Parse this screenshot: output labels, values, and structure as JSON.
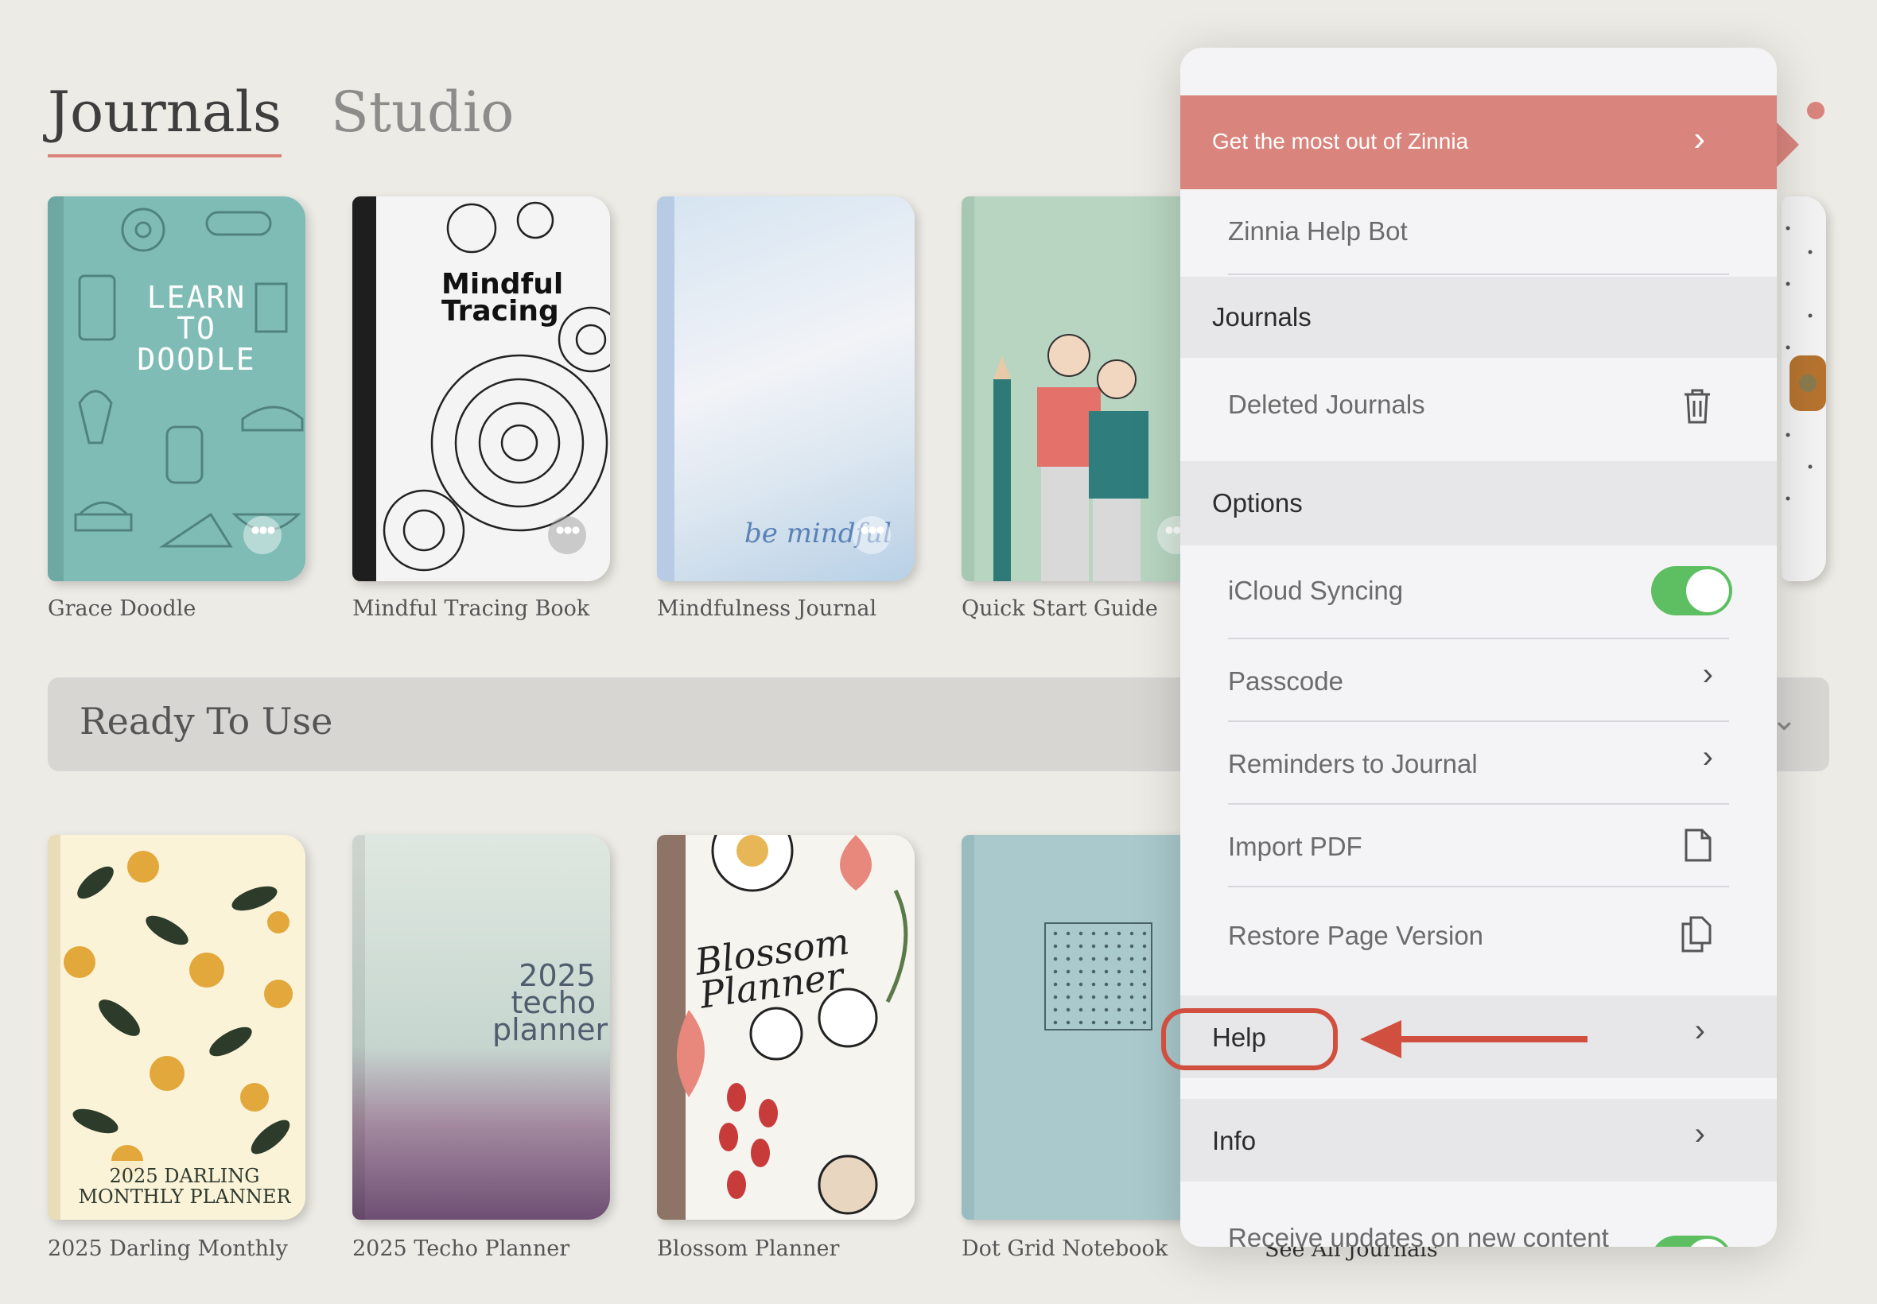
{
  "tabs": {
    "journals": "Journals",
    "studio": "Studio"
  },
  "journals": [
    {
      "caption": "Grace Doodle",
      "cover_text": "LEARN TO DOODLE"
    },
    {
      "caption": "Mindful Tracing Book",
      "cover_text": "Mindful Tracing"
    },
    {
      "caption": "Mindfulness Journal",
      "cover_text": "be mindful"
    },
    {
      "caption": "Quick Start Guide"
    }
  ],
  "ready_section": {
    "label": "Ready To Use"
  },
  "templates": [
    {
      "caption": "2025 Darling Monthly",
      "cover_text": "2025 DARLING MONTHLY PLANNER"
    },
    {
      "caption": "2025 Techo Planner",
      "cover_text": "2025 techo planner"
    },
    {
      "caption": "Blossom Planner",
      "cover_text": "Blossom Planner"
    },
    {
      "caption": "Dot Grid Notebook"
    }
  ],
  "see_all": "See All Journals",
  "more_glyph": "•••",
  "menu": {
    "promo": "Get the most out of Zinnia",
    "help_bot": "Zinnia Help Bot",
    "journals_header": "Journals",
    "deleted_journals": "Deleted Journals",
    "options_header": "Options",
    "icloud_syncing": "iCloud Syncing",
    "icloud_on": true,
    "passcode": "Passcode",
    "reminders": "Reminders to Journal",
    "import_pdf": "Import PDF",
    "restore_page": "Restore Page Version",
    "help": "Help",
    "info": "Info",
    "receive_updates": "Receive updates on new content",
    "receive_updates_on": true
  },
  "colors": {
    "accent": "#d9857d",
    "annotation": "#d14f3e",
    "toggle_on": "#5dbf62",
    "background": "#edebe5"
  },
  "icons": {
    "chevron": "chevron-right-icon",
    "trash": "trash-icon",
    "document": "document-icon",
    "copy": "copy-document-icon"
  }
}
